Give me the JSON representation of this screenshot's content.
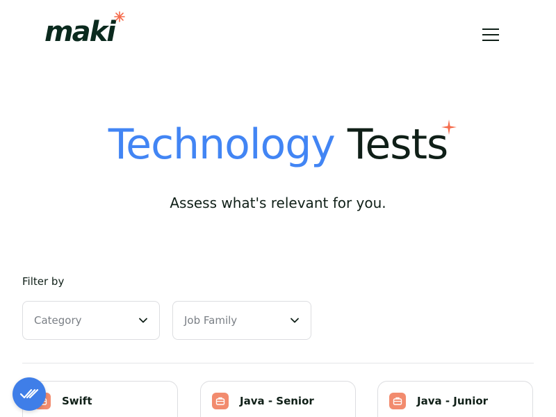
{
  "header": {
    "logo_text": "maki",
    "menu_icon": "hamburger-menu-icon"
  },
  "hero": {
    "title_part1": "Technology",
    "title_part2": "Tests",
    "subtitle": "Assess what's relevant for you."
  },
  "filters": {
    "label": "Filter by",
    "category_placeholder": "Category",
    "job_family_placeholder": "Job Family"
  },
  "cards": [
    {
      "title": "Swift",
      "icon": "briefcase-icon"
    },
    {
      "title": "Java - Senior",
      "icon": "briefcase-icon"
    },
    {
      "title": "Java - Junior",
      "icon": "briefcase-icon"
    }
  ],
  "fab": {
    "icon": "checkmarks-icon"
  },
  "colors": {
    "accent_blue": "#4285f4",
    "spark_orange": "#f56b4b",
    "text_dark": "#0f1f17",
    "card_icon": "#f28b6e",
    "fab_blue": "#3f7ee8"
  }
}
